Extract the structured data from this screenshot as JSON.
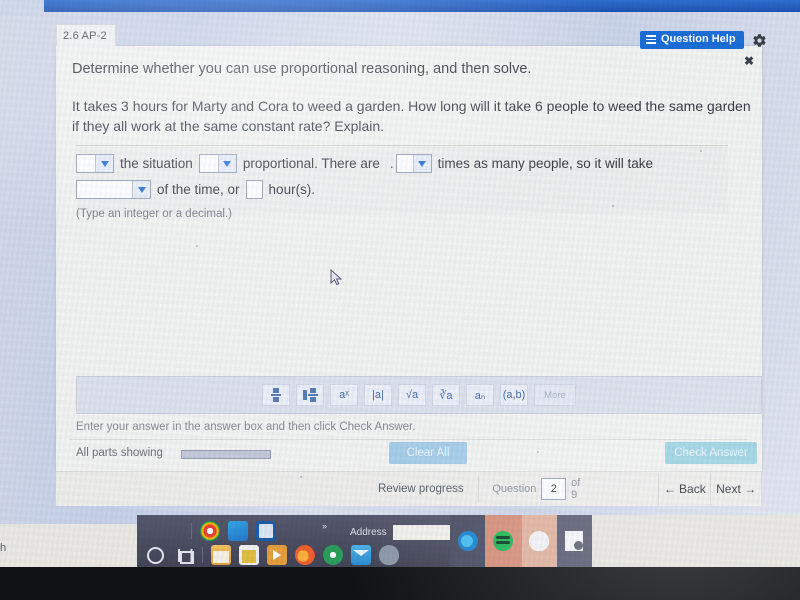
{
  "browser": {
    "tab_label": "2.6 AP-2"
  },
  "header": {
    "question_help_label": "Question Help",
    "question_help_icon": "list-icon",
    "settings_icon": "gear-icon"
  },
  "content": {
    "prompt": "Determine whether you can use proportional reasoning, and then solve.",
    "question": "It takes 3 hours for Marty and Cora to weed a garden. How long will it take 6 people to weed the same garden if they all work at the same constant rate? Explain.",
    "answer_line_1": {
      "dropdown_1_value": "",
      "text_1": "the situation",
      "dropdown_2_value": "",
      "text_2": "proportional. There are",
      "separator": ".",
      "dropdown_3_value": "",
      "text_3": "times as many people, so it will take"
    },
    "answer_line_2": {
      "dropdown_4_value": "",
      "text_1": "of the time, or",
      "input_value": "",
      "text_2": "hour(s)."
    },
    "hint": "(Type an integer or a decimal.)"
  },
  "math_toolbar": {
    "buttons": [
      {
        "name": "fraction-button",
        "label": "½"
      },
      {
        "name": "mixed-number-button",
        "label": "a½"
      },
      {
        "name": "exponent-button",
        "label": "aˣ"
      },
      {
        "name": "absolute-value-button",
        "label": "|a|"
      },
      {
        "name": "square-root-button",
        "label": "√a"
      },
      {
        "name": "nth-root-button",
        "label": "∛a"
      },
      {
        "name": "subscript-button",
        "label": "aₙ"
      },
      {
        "name": "ordered-pair-button",
        "label": "(a,b)"
      },
      {
        "name": "more-button",
        "label": "More"
      }
    ],
    "close_label": "✖"
  },
  "footer": {
    "instruction": "Enter your answer in the answer box and then click Check Answer.",
    "all_parts_showing": "All parts showing",
    "clear_all_label": "Clear All",
    "check_answer_label": "Check Answer"
  },
  "navbar": {
    "review_progress_label": "Review progress",
    "question_label": "Question",
    "question_number": "2",
    "of_label": "of 9",
    "back_label": "← Back",
    "next_label": "Next →"
  },
  "taskbar": {
    "search_icon": "cortana-circle-icon",
    "task_view_icon": "task-view-icon",
    "address_label": "Address",
    "address_value": "",
    "overflow_label": "»",
    "top_apps": [
      {
        "name": "chrome-icon"
      },
      {
        "name": "window-icon"
      },
      {
        "name": "pearson-icon"
      }
    ],
    "bottom_apps": [
      {
        "name": "file-explorer-icon"
      },
      {
        "name": "microsoft-store-icon"
      },
      {
        "name": "media-player-icon"
      },
      {
        "name": "firefox-icon"
      },
      {
        "name": "chrome-icon"
      },
      {
        "name": "mail-icon"
      },
      {
        "name": "paint-icon"
      },
      {
        "name": "edge-icon"
      },
      {
        "name": "spotify-icon"
      },
      {
        "name": "cloud-icon"
      },
      {
        "name": "document-icon"
      }
    ]
  },
  "desktop": {
    "partial_text": "h"
  }
}
